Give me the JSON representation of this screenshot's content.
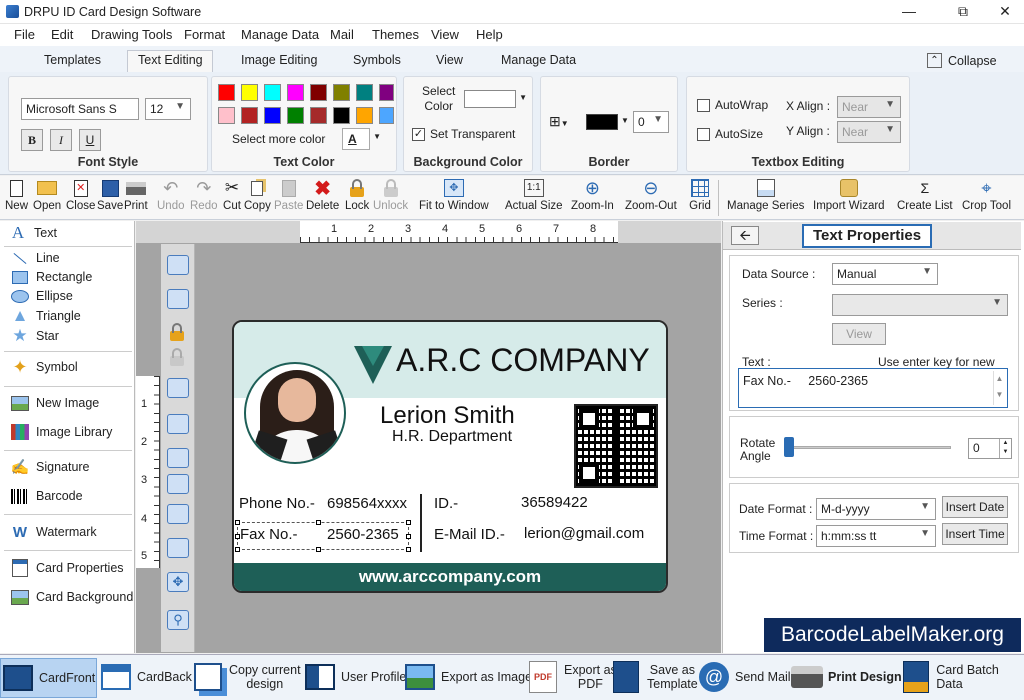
{
  "app": {
    "title": "DRPU ID Card Design Software"
  },
  "menu": [
    "File",
    "Edit",
    "Drawing Tools",
    "Format",
    "Manage Data",
    "Mail",
    "Themes",
    "View",
    "Help"
  ],
  "tabs": [
    "Templates",
    "Text Editing",
    "Image Editing",
    "Symbols",
    "View",
    "Manage Data"
  ],
  "collapse_label": "Collapse",
  "ribbon": {
    "font_style": {
      "label": "Font Style",
      "font": "Microsoft Sans S",
      "size": "12",
      "bold": "B",
      "italic": "I",
      "underline": "U"
    },
    "text_color": {
      "label": "Text Color",
      "more": "Select more color",
      "letter": "A",
      "swatches": [
        "#ff0000",
        "#ffff00",
        "#00ffff",
        "#ff00ff",
        "#800000",
        "#808000",
        "#008080",
        "#800080",
        "#ffc0cb",
        "#b22222",
        "#0000ff",
        "#008000",
        "#a52a2a",
        "#000000",
        "#ffa500",
        "#4da6ff"
      ]
    },
    "background_color": {
      "label": "Background Color",
      "select": "Select",
      "color": "Color",
      "transparent": "Set Transparent"
    },
    "border": {
      "label": "Border",
      "width": "0"
    },
    "textbox": {
      "label": "Textbox Editing",
      "autowrap": "AutoWrap",
      "autosize": "AutoSize",
      "xalign": "X Align :",
      "yalign": "Y Align :",
      "xval": "Near",
      "yval": "Near"
    }
  },
  "toolbar": {
    "new": "New",
    "open": "Open",
    "close": "Close",
    "save": "Save",
    "print": "Print",
    "undo": "Undo",
    "redo": "Redo",
    "cut": "Cut",
    "copy": "Copy",
    "paste": "Paste",
    "delete": "Delete",
    "lock": "Lock",
    "unlock": "Unlock",
    "fit": "Fit to Window",
    "actual": "Actual Size",
    "zoomin": "Zoom-In",
    "zoomout": "Zoom-Out",
    "grid": "Grid",
    "series": "Manage Series",
    "wizard": "Import Wizard",
    "list": "Create List",
    "crop": "Crop Tool",
    "actual_glyph": "1:1"
  },
  "tools": {
    "text": "Text",
    "line": "Line",
    "rectangle": "Rectangle",
    "ellipse": "Ellipse",
    "triangle": "Triangle",
    "star": "Star",
    "symbol": "Symbol",
    "new_image": "New Image",
    "image_library": "Image Library",
    "signature": "Signature",
    "barcode": "Barcode",
    "watermark": "Watermark",
    "card_properties": "Card Properties",
    "card_background": "Card Background"
  },
  "ruler": {
    "h": [
      "1",
      "2",
      "3",
      "4",
      "5",
      "6",
      "7",
      "8"
    ],
    "v": [
      "1",
      "2",
      "3",
      "4",
      "5"
    ]
  },
  "card": {
    "company": "A.R.C COMPANY",
    "name": "Lerion Smith",
    "department": "H.R. Department",
    "phone_label": "Phone No.-",
    "phone": "698564xxxx",
    "fax_label": "Fax No.-",
    "fax": "2560-2365",
    "id_label": "ID.-",
    "id": "36589422",
    "email_label": "E-Mail ID.-",
    "email": "lerion@gmail.com",
    "website": "www.arccompany.com",
    "accent": "#1e5f57",
    "header_bg": "#d6ebe9"
  },
  "props": {
    "title": "Text Properties",
    "data_source_label": "Data Source :",
    "data_source": "Manual",
    "series_label": "Series :",
    "view": "View",
    "text_label": "Text :",
    "hint": "Use enter key for new line.",
    "text_value": "Fax No.-     2560-2365",
    "rotate_label1": "Rotate",
    "rotate_label2": "Angle",
    "rotate_value": "0",
    "date_label": "Date Format :",
    "date_value": "M-d-yyyy",
    "insert_date": "Insert Date",
    "time_label": "Time Format :",
    "time_value": "h:mm:ss tt",
    "insert_time": "Insert Time"
  },
  "watermark_brand": "BarcodeLabelMaker.org",
  "bottom": {
    "card_front": "CardFront",
    "card_back": "CardBack",
    "copy1": "Copy current",
    "copy2": "design",
    "user_profile": "User Profile",
    "export_image": "Export as Image",
    "export_pdf1": "Export as",
    "export_pdf2": "PDF",
    "save_tpl1": "Save as",
    "save_tpl2": "Template",
    "send_mail": "Send Mail",
    "print_design": "Print Design",
    "batch": "Card Batch Data",
    "pdf_glyph": "PDF"
  }
}
